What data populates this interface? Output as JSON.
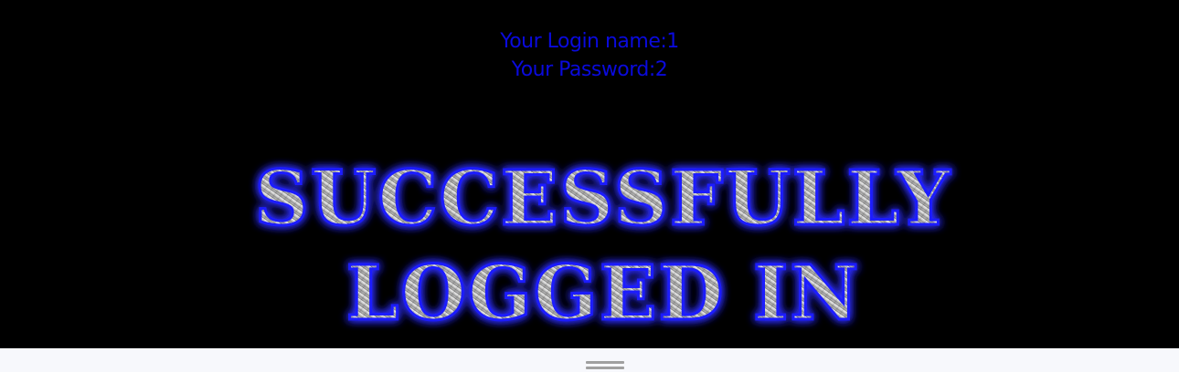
{
  "login": {
    "name_label": "Your Login name:1",
    "password_label": "Your Password:2"
  },
  "banner": {
    "line1": "SUCCESSFULLY",
    "line2": "LOGGED IN"
  },
  "colors": {
    "background": "#000000",
    "info_text": "#0a0adc",
    "glow": "#2a2aff",
    "bottom_bar": "#f7f8fc",
    "handle": "#a0a0a0"
  },
  "icons": {
    "bottom_handle": "drag-handle-icon"
  }
}
